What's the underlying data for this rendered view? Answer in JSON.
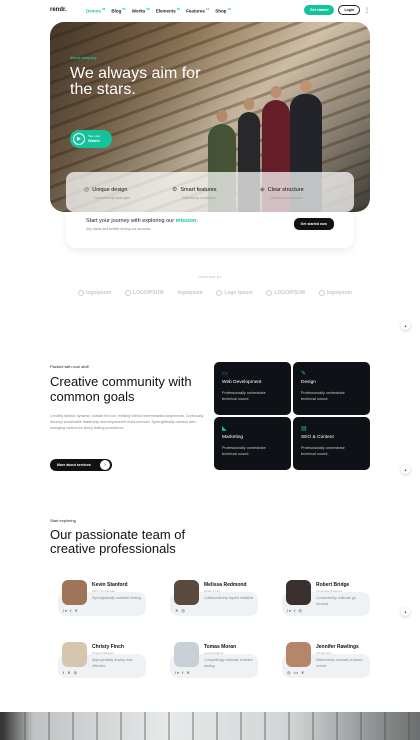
{
  "nav": {
    "logo": "rendr.",
    "items": [
      {
        "label": "Demos",
        "badge": "26",
        "active": true
      },
      {
        "label": "Blog",
        "badge": "05",
        "active": false
      },
      {
        "label": "Works",
        "badge": "08",
        "active": false
      },
      {
        "label": "Elements",
        "badge": "22",
        "active": false
      },
      {
        "label": "Features",
        "badge": "12",
        "active": false
      },
      {
        "label": "Shop",
        "badge": "10",
        "active": false
      }
    ],
    "get_started": "Get started",
    "login": "Login"
  },
  "hero": {
    "tag": "About company",
    "title": "We always aim for the stars.",
    "watch_small": "Take a tour",
    "watch_big": "Watch",
    "features": [
      {
        "icon": "target-icon",
        "glyph": "◎",
        "title": "Unique design",
        "sub": "Conveniently synergize"
      },
      {
        "icon": "settings-icon",
        "glyph": "⚙",
        "title": "Smart features",
        "sub": "Objectively conditions"
      },
      {
        "icon": "layers-icon",
        "glyph": "◈",
        "title": "Clear structure",
        "sub": "Creatively productize"
      }
    ],
    "journey_text": "Start your journey with exploring our ",
    "journey_highlight": "mission.",
    "journey_sub": "Key ideas and beliefs driving our success.",
    "journey_button": "Get started now"
  },
  "trusted": {
    "label": "TRUSTED BY",
    "logos": [
      "logoipsum",
      "LOGOIPSUM",
      "logoipsum",
      "Logo Ipsum",
      "LOGOIPSUM",
      "logoipsum"
    ]
  },
  "community": {
    "packed": "Packed with cool stuff",
    "title": "Creative community with common goals",
    "text": "Credibly fashion dynamic 'outside the box' thinking without intermediated alignments. Continually develop sustainable leadership and empowered meta-services. Synergistically unleash wire-emerging metrics for sticky testing procedures.",
    "button": "More about services",
    "services": [
      {
        "icon": "monitor-icon",
        "glyph": "▭",
        "title": "Web Development",
        "desc": "Professionally orchestrate technical sound."
      },
      {
        "icon": "pen-icon",
        "glyph": "✎",
        "title": "Design",
        "desc": "Professionally orchestrate technical sound."
      },
      {
        "icon": "megaphone-icon",
        "glyph": "◣",
        "title": "Marketing",
        "desc": "Professionally orchestrate technical sound."
      },
      {
        "icon": "chart-icon",
        "glyph": "▤",
        "title": "SEO & Content",
        "desc": "Professionally orchestrate technical sound."
      }
    ]
  },
  "team": {
    "label": "Start exploring",
    "title": "Our passionate team of creative professionals",
    "members": [
      {
        "name": "Kevin Stanford",
        "role": "CEO, Co-founder",
        "desc": "Synergistically scalable testing",
        "social": "in f ✕",
        "color": "#a07458"
      },
      {
        "name": "Melissa Redmond",
        "role": "Head of HR",
        "desc": "Collaboratively exploit installed",
        "social": "✕ ◎",
        "color": "#5b4a3e"
      },
      {
        "name": "Robert Bridge",
        "role": "Corporate Relations",
        "desc": "Conveniently cultivate go forward",
        "social": "in f ◎",
        "color": "#3a3030"
      },
      {
        "name": "Christy Finch",
        "role": "Project Manager",
        "desc": "Appropriately deploy cost effective",
        "social": "f ✕ ◎",
        "color": "#d7c6ae"
      },
      {
        "name": "Tomas Moran",
        "role": "Lead Designer",
        "desc": "Compellingly cultivate enabled testing",
        "social": "in f ✕",
        "color": "#c9cfd6"
      },
      {
        "name": "Jennifer Rawlings",
        "role": "VP Security",
        "desc": "Distinctively unleash process-centric",
        "social": "◎ in ✕",
        "color": "#b5876a"
      }
    ]
  },
  "colors": {
    "accent": "#15c39a",
    "dark": "#0e1216"
  }
}
